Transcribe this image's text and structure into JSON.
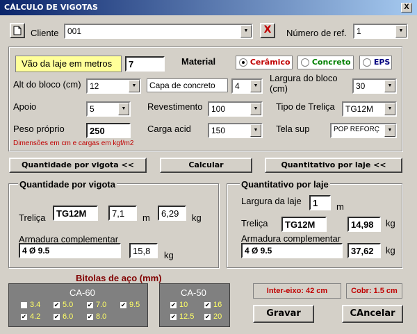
{
  "window": {
    "title": "CÁLCULO DE VIGOTAS",
    "close": "X"
  },
  "top": {
    "new_icon": "document-icon",
    "client_label": "Cliente",
    "client_value": "001",
    "delete_icon": "X",
    "ref_label": "Número de ref.",
    "ref_value": "1"
  },
  "params": {
    "vao_label": "Vão da laje em metros",
    "vao_value": "7",
    "material_label": "Material",
    "material_options": [
      "Cerâmico",
      "Concreto",
      "EPS"
    ],
    "material_selected": "Cerâmico",
    "alt_bloco_label": "Alt do bloco (cm)",
    "alt_bloco_value": "12",
    "capa_label": "Capa de concreto",
    "capa_value": "4",
    "largura_bloco_label": "Largura do bloco (cm)",
    "largura_bloco_value": "30",
    "apoio_label": "Apoio",
    "apoio_value": "5",
    "revestimento_label": "Revestimento",
    "revestimento_value": "100",
    "tipo_trelica_label": "Tipo de Treliça",
    "tipo_trelica_value": "TG12M",
    "peso_label": "Peso próprio",
    "peso_value": "250",
    "carga_label": "Carga acid",
    "carga_value": "150",
    "tela_label": "Tela sup",
    "tela_value": "POP REFORÇ",
    "note": "Dimensões em cm e cargas em kgf/m2"
  },
  "actions": {
    "qtd_vigota": "Quantidade por vigota <<",
    "calcular": "Calcular",
    "qtd_laje": "Quantitativo por laje <<"
  },
  "vigota": {
    "title": "Quantidade por vigota",
    "trelica_label": "Treliça",
    "trelica_value": "TG12M",
    "trelica_m": "7,1",
    "m_unit": "m",
    "trelica_kg": "6,29",
    "kg_unit": "kg",
    "armadura_label": "Armadura complementar",
    "armadura_value": "4 Ø 9.5",
    "armadura_kg": "15,8"
  },
  "laje": {
    "title": "Quantitativo por laje",
    "largura_label": "Largura da laje",
    "largura_value": "1",
    "m_unit": "m",
    "trelica_label": "Treliça",
    "trelica_value": "TG12M",
    "trelica_kg": "14,98",
    "kg_unit": "kg",
    "armadura_label": "Armadura complementar",
    "armadura_value": "4 Ø 9.5",
    "armadura_kg": "37,62"
  },
  "bitolas": {
    "title": "Bitolas de aço (mm)",
    "ca60": {
      "title": "CA-60",
      "items": [
        {
          "label": "3.4",
          "checked": false
        },
        {
          "label": "5.0",
          "checked": true
        },
        {
          "label": "7.0",
          "checked": true
        },
        {
          "label": "9.5",
          "checked": true
        },
        {
          "label": "4.2",
          "checked": true
        },
        {
          "label": "6.0",
          "checked": true
        },
        {
          "label": "8.0",
          "checked": true
        }
      ]
    },
    "ca50": {
      "title": "CA-50",
      "items": [
        {
          "label": "10",
          "checked": true
        },
        {
          "label": "16",
          "checked": true
        },
        {
          "label": "12.5",
          "checked": true
        },
        {
          "label": "20",
          "checked": true
        }
      ]
    }
  },
  "info": {
    "inter_eixo": "Inter-eixo:  42 cm",
    "cobr": "Cobr: 1.5 cm"
  },
  "footer": {
    "gravar": "Gravar",
    "cancelar": "CAncelar"
  },
  "colors": {
    "title_start": "#0a246a",
    "red_text": "#c00000",
    "check_label": "#ffff66",
    "highlight": "#ffff99"
  }
}
